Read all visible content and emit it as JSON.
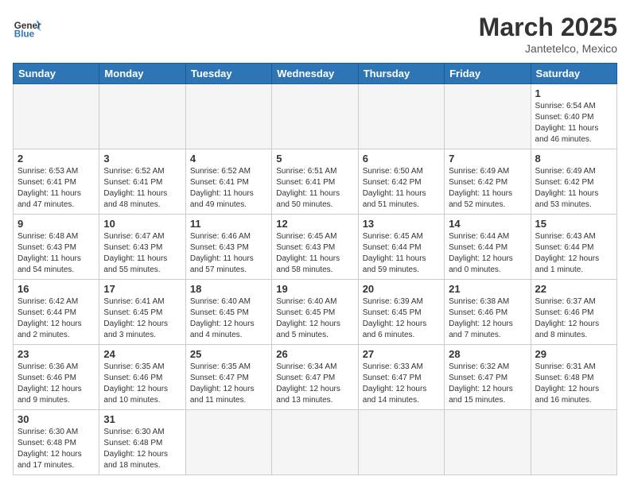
{
  "header": {
    "logo_general": "General",
    "logo_blue": "Blue",
    "month_title": "March 2025",
    "location": "Jantetelco, Mexico"
  },
  "weekdays": [
    "Sunday",
    "Monday",
    "Tuesday",
    "Wednesday",
    "Thursday",
    "Friday",
    "Saturday"
  ],
  "weeks": [
    [
      {
        "day": "",
        "info": ""
      },
      {
        "day": "",
        "info": ""
      },
      {
        "day": "",
        "info": ""
      },
      {
        "day": "",
        "info": ""
      },
      {
        "day": "",
        "info": ""
      },
      {
        "day": "",
        "info": ""
      },
      {
        "day": "1",
        "info": "Sunrise: 6:54 AM\nSunset: 6:40 PM\nDaylight: 11 hours\nand 46 minutes."
      }
    ],
    [
      {
        "day": "2",
        "info": "Sunrise: 6:53 AM\nSunset: 6:41 PM\nDaylight: 11 hours\nand 47 minutes."
      },
      {
        "day": "3",
        "info": "Sunrise: 6:52 AM\nSunset: 6:41 PM\nDaylight: 11 hours\nand 48 minutes."
      },
      {
        "day": "4",
        "info": "Sunrise: 6:52 AM\nSunset: 6:41 PM\nDaylight: 11 hours\nand 49 minutes."
      },
      {
        "day": "5",
        "info": "Sunrise: 6:51 AM\nSunset: 6:41 PM\nDaylight: 11 hours\nand 50 minutes."
      },
      {
        "day": "6",
        "info": "Sunrise: 6:50 AM\nSunset: 6:42 PM\nDaylight: 11 hours\nand 51 minutes."
      },
      {
        "day": "7",
        "info": "Sunrise: 6:49 AM\nSunset: 6:42 PM\nDaylight: 11 hours\nand 52 minutes."
      },
      {
        "day": "8",
        "info": "Sunrise: 6:49 AM\nSunset: 6:42 PM\nDaylight: 11 hours\nand 53 minutes."
      }
    ],
    [
      {
        "day": "9",
        "info": "Sunrise: 6:48 AM\nSunset: 6:43 PM\nDaylight: 11 hours\nand 54 minutes."
      },
      {
        "day": "10",
        "info": "Sunrise: 6:47 AM\nSunset: 6:43 PM\nDaylight: 11 hours\nand 55 minutes."
      },
      {
        "day": "11",
        "info": "Sunrise: 6:46 AM\nSunset: 6:43 PM\nDaylight: 11 hours\nand 57 minutes."
      },
      {
        "day": "12",
        "info": "Sunrise: 6:45 AM\nSunset: 6:43 PM\nDaylight: 11 hours\nand 58 minutes."
      },
      {
        "day": "13",
        "info": "Sunrise: 6:45 AM\nSunset: 6:44 PM\nDaylight: 11 hours\nand 59 minutes."
      },
      {
        "day": "14",
        "info": "Sunrise: 6:44 AM\nSunset: 6:44 PM\nDaylight: 12 hours\nand 0 minutes."
      },
      {
        "day": "15",
        "info": "Sunrise: 6:43 AM\nSunset: 6:44 PM\nDaylight: 12 hours\nand 1 minute."
      }
    ],
    [
      {
        "day": "16",
        "info": "Sunrise: 6:42 AM\nSunset: 6:44 PM\nDaylight: 12 hours\nand 2 minutes."
      },
      {
        "day": "17",
        "info": "Sunrise: 6:41 AM\nSunset: 6:45 PM\nDaylight: 12 hours\nand 3 minutes."
      },
      {
        "day": "18",
        "info": "Sunrise: 6:40 AM\nSunset: 6:45 PM\nDaylight: 12 hours\nand 4 minutes."
      },
      {
        "day": "19",
        "info": "Sunrise: 6:40 AM\nSunset: 6:45 PM\nDaylight: 12 hours\nand 5 minutes."
      },
      {
        "day": "20",
        "info": "Sunrise: 6:39 AM\nSunset: 6:45 PM\nDaylight: 12 hours\nand 6 minutes."
      },
      {
        "day": "21",
        "info": "Sunrise: 6:38 AM\nSunset: 6:46 PM\nDaylight: 12 hours\nand 7 minutes."
      },
      {
        "day": "22",
        "info": "Sunrise: 6:37 AM\nSunset: 6:46 PM\nDaylight: 12 hours\nand 8 minutes."
      }
    ],
    [
      {
        "day": "23",
        "info": "Sunrise: 6:36 AM\nSunset: 6:46 PM\nDaylight: 12 hours\nand 9 minutes."
      },
      {
        "day": "24",
        "info": "Sunrise: 6:35 AM\nSunset: 6:46 PM\nDaylight: 12 hours\nand 10 minutes."
      },
      {
        "day": "25",
        "info": "Sunrise: 6:35 AM\nSunset: 6:47 PM\nDaylight: 12 hours\nand 11 minutes."
      },
      {
        "day": "26",
        "info": "Sunrise: 6:34 AM\nSunset: 6:47 PM\nDaylight: 12 hours\nand 13 minutes."
      },
      {
        "day": "27",
        "info": "Sunrise: 6:33 AM\nSunset: 6:47 PM\nDaylight: 12 hours\nand 14 minutes."
      },
      {
        "day": "28",
        "info": "Sunrise: 6:32 AM\nSunset: 6:47 PM\nDaylight: 12 hours\nand 15 minutes."
      },
      {
        "day": "29",
        "info": "Sunrise: 6:31 AM\nSunset: 6:48 PM\nDaylight: 12 hours\nand 16 minutes."
      }
    ],
    [
      {
        "day": "30",
        "info": "Sunrise: 6:30 AM\nSunset: 6:48 PM\nDaylight: 12 hours\nand 17 minutes."
      },
      {
        "day": "31",
        "info": "Sunrise: 6:30 AM\nSunset: 6:48 PM\nDaylight: 12 hours\nand 18 minutes."
      },
      {
        "day": "",
        "info": ""
      },
      {
        "day": "",
        "info": ""
      },
      {
        "day": "",
        "info": ""
      },
      {
        "day": "",
        "info": ""
      },
      {
        "day": "",
        "info": ""
      }
    ]
  ]
}
